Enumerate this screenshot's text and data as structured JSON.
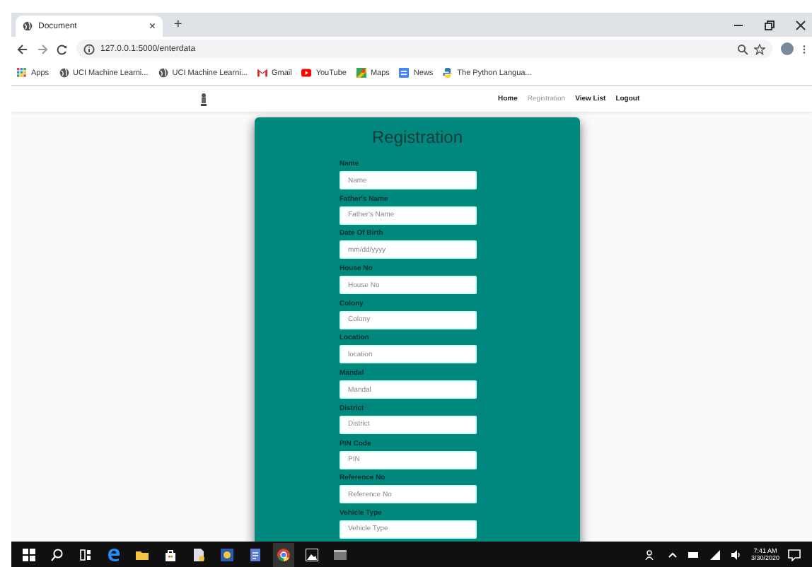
{
  "browser": {
    "tab_title": "Document",
    "tab_close": "×",
    "new_tab": "+",
    "url": "127.0.0.1:5000/enterdata",
    "bookmarks": [
      {
        "label": "Apps",
        "kind": "apps"
      },
      {
        "label": "UCI Machine Learni...",
        "kind": "globe"
      },
      {
        "label": "UCI Machine Learni...",
        "kind": "globe"
      },
      {
        "label": "Gmail",
        "kind": "gmail"
      },
      {
        "label": "YouTube",
        "kind": "youtube"
      },
      {
        "label": "Maps",
        "kind": "maps"
      },
      {
        "label": "News",
        "kind": "news"
      },
      {
        "label": "The Python Langua...",
        "kind": "python"
      }
    ]
  },
  "nav": {
    "items": [
      {
        "label": "Home",
        "selected": false
      },
      {
        "label": "Registration",
        "selected": true
      },
      {
        "label": "View List",
        "selected": false
      },
      {
        "label": "Logout",
        "selected": false
      }
    ]
  },
  "form": {
    "title": "Registration",
    "fields": [
      {
        "label": "Name",
        "placeholder": "Name"
      },
      {
        "label": "Father's Name",
        "placeholder": "Father's Name"
      },
      {
        "label": "Date Of Birth",
        "placeholder": "mm/dd/yyyy"
      },
      {
        "label": "House No",
        "placeholder": "House No"
      },
      {
        "label": "Colony",
        "placeholder": "Colony"
      },
      {
        "label": "Location",
        "placeholder": "location"
      },
      {
        "label": "Mandal",
        "placeholder": "Mandal"
      },
      {
        "label": "District",
        "placeholder": "District"
      },
      {
        "label": "PIN Code",
        "placeholder": "PIN"
      },
      {
        "label": "Reference No",
        "placeholder": "Reference No"
      },
      {
        "label": "Vehicle Type",
        "placeholder": "Vehicle Type"
      }
    ]
  },
  "taskbar": {
    "time": "7:41 AM",
    "date": "3/30/2020"
  }
}
